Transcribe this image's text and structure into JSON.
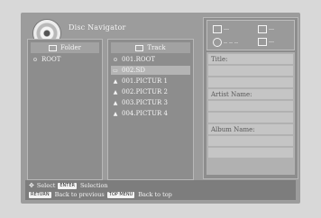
{
  "screen": {
    "title": "Disc Navigator"
  },
  "folder_panel": {
    "header": "Folder",
    "items": [
      {
        "label": "ROOT"
      }
    ]
  },
  "track_panel": {
    "header": "Track",
    "items": [
      {
        "label": "001.ROOT",
        "glyph": "⊙"
      },
      {
        "label": "002.SD",
        "glyph": "▭"
      },
      {
        "label": "001.PICTUR 1",
        "glyph": "▲"
      },
      {
        "label": "002.PICTUR 2",
        "glyph": "▲"
      },
      {
        "label": "003.PICTUR 3",
        "glyph": "▲"
      },
      {
        "label": "004.PICTUR 4",
        "glyph": "▲"
      }
    ],
    "selected_index": 1
  },
  "info_panel": {
    "status": {
      "item1": "---",
      "item2": "---",
      "item3": "-- -- --",
      "item4": "---"
    },
    "fields": {
      "title_label": "Title:",
      "artist_label": "Artist Name:",
      "album_label": "Album Name:"
    }
  },
  "help": {
    "select_label": "Select",
    "enter_key": "ENTER",
    "selection_label": "Selection",
    "return_key": "RETURN",
    "back_previous_label": "Back to previous",
    "topmenu_key": "TOP MENU",
    "back_top_label": "Back to top"
  }
}
